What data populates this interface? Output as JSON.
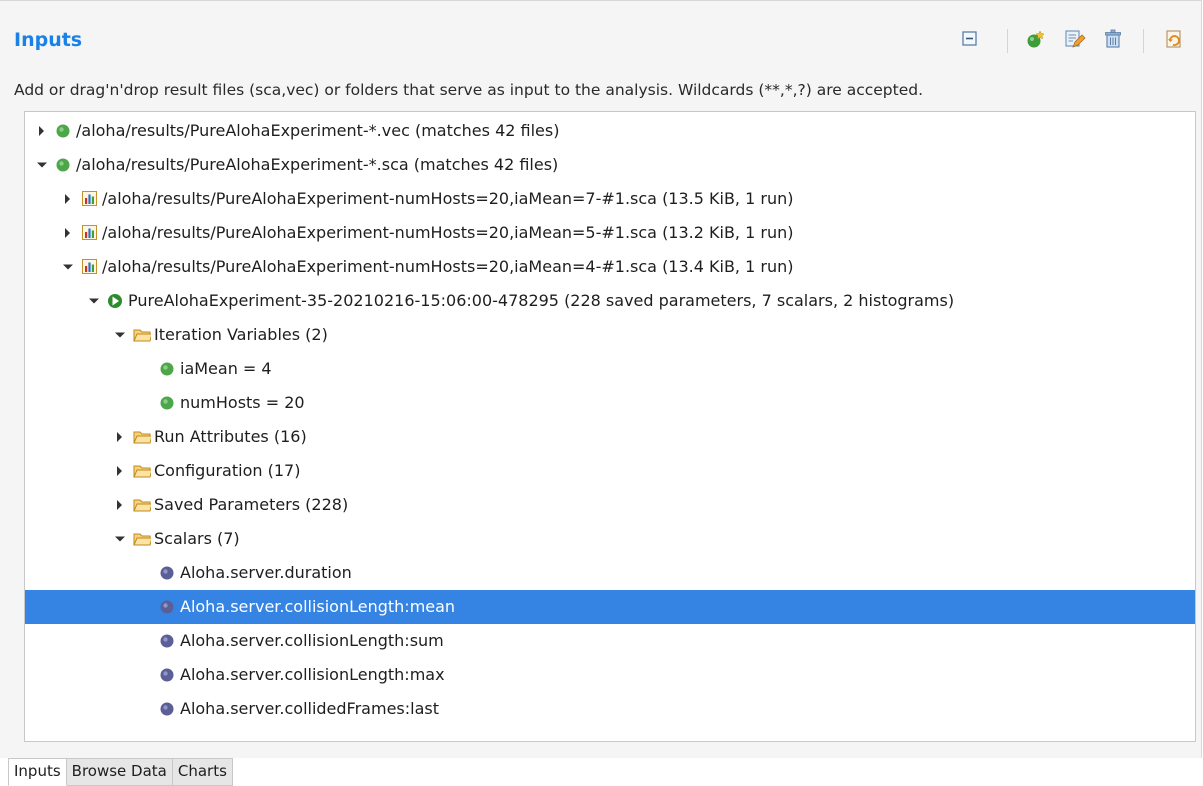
{
  "panel": {
    "title": "Inputs",
    "description": "Add or drag'n'drop result files (sca,vec) or folders that serve as input to the analysis. Wildcards (**,*,?) are accepted."
  },
  "toolbar": {
    "buttons": [
      {
        "icon": "collapse-all-icon"
      },
      {
        "icon": "add-file-icon"
      },
      {
        "icon": "edit-icon"
      },
      {
        "icon": "delete-icon"
      },
      {
        "icon": "refresh-icon"
      }
    ]
  },
  "tree": {
    "rows": [
      {
        "depth": 0,
        "toggle": "collapsed",
        "icon": "green-dot-icon",
        "label": "/aloha/results/PureAlohaExperiment-*.vec  (matches 42 files)"
      },
      {
        "depth": 0,
        "toggle": "expanded",
        "icon": "green-dot-icon",
        "label": "/aloha/results/PureAlohaExperiment-*.sca  (matches 42 files)"
      },
      {
        "depth": 1,
        "toggle": "collapsed",
        "icon": "result-file-icon",
        "label": "/aloha/results/PureAlohaExperiment-numHosts=20,iaMean=7-#1.sca  (13.5 KiB, 1 run)"
      },
      {
        "depth": 1,
        "toggle": "collapsed",
        "icon": "result-file-icon",
        "label": "/aloha/results/PureAlohaExperiment-numHosts=20,iaMean=5-#1.sca  (13.2 KiB, 1 run)"
      },
      {
        "depth": 1,
        "toggle": "expanded",
        "icon": "result-file-icon",
        "label": "/aloha/results/PureAlohaExperiment-numHosts=20,iaMean=4-#1.sca  (13.4 KiB, 1 run)"
      },
      {
        "depth": 2,
        "toggle": "expanded",
        "icon": "run-icon",
        "label": "PureAlohaExperiment-35-20210216-15:06:00-478295  (228 saved parameters, 7 scalars, 2 histograms)"
      },
      {
        "depth": 3,
        "toggle": "expanded",
        "icon": "folder-icon",
        "label": "Iteration Variables (2)"
      },
      {
        "depth": 4,
        "toggle": "none",
        "icon": "green-dot-icon",
        "label": "iaMean = 4"
      },
      {
        "depth": 4,
        "toggle": "none",
        "icon": "green-dot-icon",
        "label": "numHosts = 20"
      },
      {
        "depth": 3,
        "toggle": "collapsed",
        "icon": "folder-icon",
        "label": "Run Attributes (16)"
      },
      {
        "depth": 3,
        "toggle": "collapsed",
        "icon": "folder-icon",
        "label": "Configuration (17)"
      },
      {
        "depth": 3,
        "toggle": "collapsed",
        "icon": "folder-icon",
        "label": "Saved Parameters (228)"
      },
      {
        "depth": 3,
        "toggle": "expanded",
        "icon": "folder-icon",
        "label": "Scalars (7)"
      },
      {
        "depth": 4,
        "toggle": "none",
        "icon": "scalar-icon",
        "label": "Aloha.server.duration"
      },
      {
        "depth": 4,
        "toggle": "none",
        "icon": "scalar-icon",
        "label": "Aloha.server.collisionLength:mean",
        "selected": true
      },
      {
        "depth": 4,
        "toggle": "none",
        "icon": "scalar-icon",
        "label": "Aloha.server.collisionLength:sum"
      },
      {
        "depth": 4,
        "toggle": "none",
        "icon": "scalar-icon",
        "label": "Aloha.server.collisionLength:max"
      },
      {
        "depth": 4,
        "toggle": "none",
        "icon": "scalar-icon",
        "label": "Aloha.server.collidedFrames:last"
      }
    ]
  },
  "tabs": [
    {
      "label": "Inputs",
      "active": true
    },
    {
      "label": "Browse Data"
    },
    {
      "label": "Charts"
    }
  ]
}
